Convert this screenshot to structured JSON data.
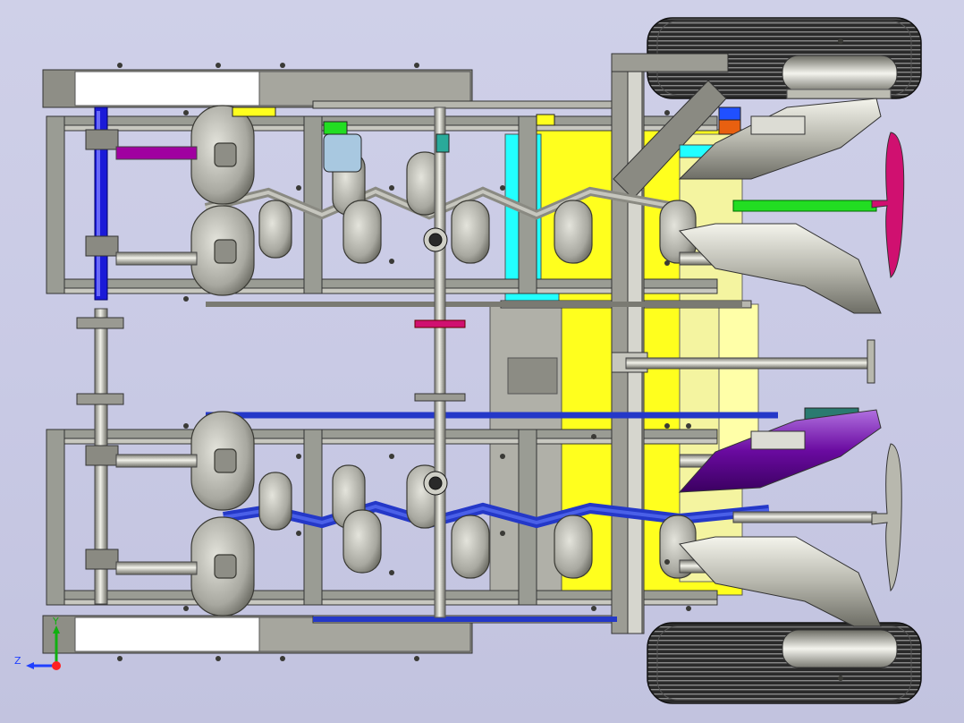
{
  "viewport": {
    "background": "#cacbe5",
    "colors": {
      "frame": "#9a9c94",
      "frame_dark": "#55574f",
      "metal": "#c8c8bf",
      "yellow": "#ffff1e",
      "cyan": "#22ffff",
      "blue": "#1a1ad8",
      "belt_blue": "#2438c8",
      "purple": "#6a0aa0",
      "magenta": "#d01070",
      "green": "#22dd22",
      "teal": "#2a7a70",
      "orange": "#e86010",
      "tire": "#2a2a2a"
    }
  },
  "triad": {
    "x_label": "",
    "y_label": "Y",
    "z_label": "Z",
    "x_color": "#ff2020",
    "y_color": "#10b010",
    "z_color": "#2040ff"
  }
}
